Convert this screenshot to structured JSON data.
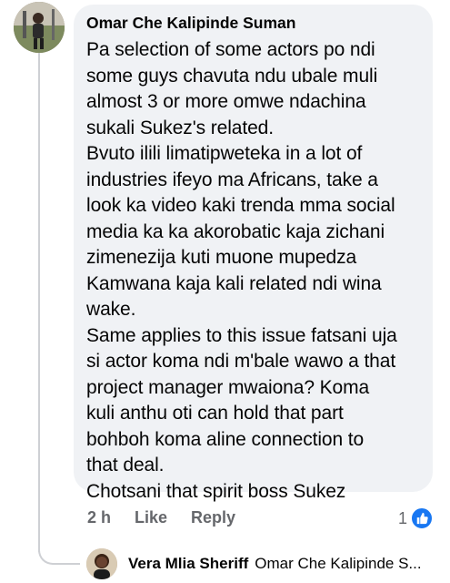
{
  "comment": {
    "author": "Omar Che Kalipinde Suman",
    "lines": [
      "Pa selection of some actors po ndi",
      "some guys chavuta ndu ubale muli",
      "almost 3 or more omwe ndachina",
      "sukali Sukez's related.",
      "Bvuto ilili limatipweteka in a lot of",
      "industries ifeyo ma Africans, take a",
      "look ka video kaki trenda mma social",
      "media ka ka akorobatic kaja zichani",
      "zimenezija kuti muone mupedza",
      "Kamwana kaja kali related ndi wina",
      "wake.",
      "Same applies to this issue fatsani uja",
      "si actor koma ndi m'bale wawo a that",
      "project manager mwaiona? Koma",
      "kuli anthu oti can hold that part",
      "bohboh koma aline connection to",
      "that deal.",
      "Chotsani that spirit boss Sukez"
    ],
    "time": "2 h",
    "like_label": "Like",
    "reply_label": "Reply",
    "reaction_count": "1",
    "reaction_icon": "thumbs-up-icon",
    "reaction_color": "#1877f2"
  },
  "reply_preview": {
    "author": "Vera Mlia Sheriff",
    "snippet": "Omar Che Kalipinde S..."
  }
}
